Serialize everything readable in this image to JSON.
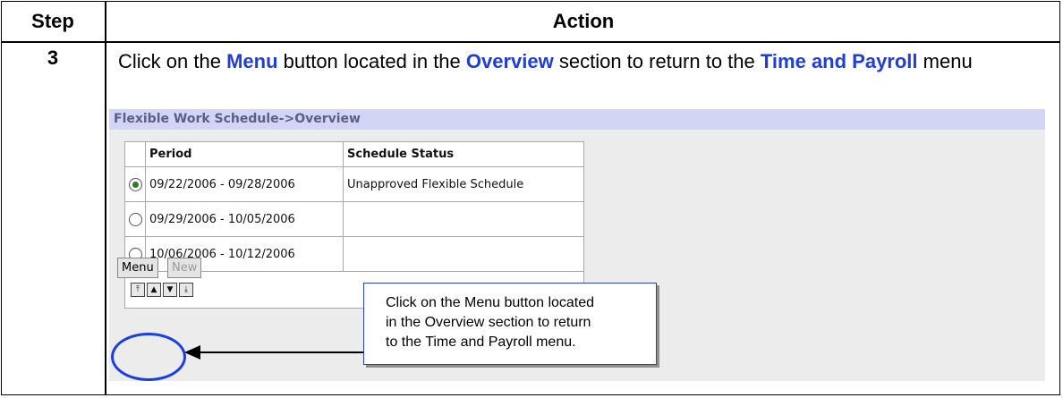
{
  "table": {
    "header_step": "Step",
    "header_action": "Action",
    "step_number": "3"
  },
  "instruction": {
    "t1": "Click on the ",
    "k1": "Menu",
    "t2": " button located in the ",
    "k2": "Overview",
    "t3": " section to return to the ",
    "k3": "Time and Payroll",
    "t4": " menu"
  },
  "screenshot": {
    "breadcrumb": "Flexible Work Schedule->Overview",
    "columns": [
      "Period",
      "Schedule Status"
    ],
    "rows": [
      {
        "selected": true,
        "period": "09/22/2006 - 09/28/2006",
        "status": "Unapproved Flexible Schedule"
      },
      {
        "selected": false,
        "period": "09/29/2006 - 10/05/2006",
        "status": ""
      },
      {
        "selected": false,
        "period": "10/06/2006 - 10/12/2006",
        "status": ""
      }
    ],
    "nav_icons": [
      "first-page-icon",
      "previous-page-icon",
      "next-page-icon",
      "last-page-icon"
    ],
    "menu_button": "Menu",
    "new_button": "New"
  },
  "callout": {
    "line1": "Click on the Menu button located",
    "line2": "in the Overview section to return",
    "line3": "to the Time and Payroll menu."
  },
  "colors": {
    "keyword": "#1f3ed9",
    "title_bar": "#d4d4f4",
    "highlight_ring": "#1a3ee6"
  }
}
